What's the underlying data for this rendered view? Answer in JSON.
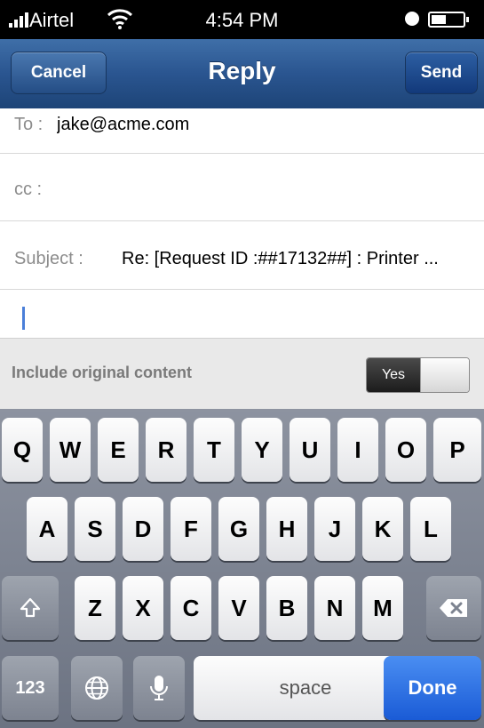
{
  "status_bar": {
    "carrier": "Airtel",
    "time": "4:54 PM"
  },
  "nav": {
    "title": "Reply",
    "cancel_label": "Cancel",
    "send_label": "Send"
  },
  "form": {
    "to_label": "To :",
    "to_value": "jake@acme.com",
    "cc_label": "cc :",
    "cc_value": "",
    "subject_label": "Subject :",
    "subject_value": "Re: [Request ID :##17132##] : Printer ..."
  },
  "include_original": {
    "label": "Include original content",
    "toggle_label": "Yes",
    "enabled": true
  },
  "keyboard": {
    "row1": [
      "Q",
      "W",
      "E",
      "R",
      "T",
      "Y",
      "U",
      "I",
      "O",
      "P"
    ],
    "row2": [
      "A",
      "S",
      "D",
      "F",
      "G",
      "H",
      "J",
      "K",
      "L"
    ],
    "row3": [
      "Z",
      "X",
      "C",
      "V",
      "B",
      "N",
      "M"
    ],
    "numbers_label": "123",
    "space_label": "space",
    "done_label": "Done"
  },
  "colors": {
    "nav_blue": "#2a5590",
    "done_blue": "#1a5bd6",
    "cursor_blue": "#4a7fd9"
  },
  "icons": [
    "signal-icon",
    "wifi-icon",
    "lock-icon",
    "battery-icon",
    "shift-icon",
    "globe-icon",
    "microphone-icon",
    "backspace-icon"
  ]
}
